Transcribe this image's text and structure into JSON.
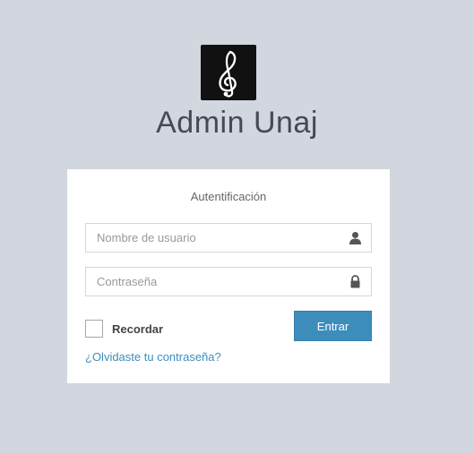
{
  "app": {
    "title": "Admin Unaj",
    "logo_icon": "treble-clef-icon"
  },
  "login": {
    "subtitle": "Autentificación",
    "username": {
      "placeholder": "Nombre de usuario",
      "value": "",
      "icon": "user-icon"
    },
    "password": {
      "placeholder": "Contraseña",
      "value": "",
      "icon": "lock-icon"
    },
    "remember_label": "Recordar",
    "remember_checked": false,
    "submit_label": "Entrar",
    "forgot_label": "¿Olvidaste tu contraseña?"
  },
  "colors": {
    "background": "#d2d6de",
    "card": "#ffffff",
    "accent": "#3c8dbc",
    "logo": "#111111"
  }
}
